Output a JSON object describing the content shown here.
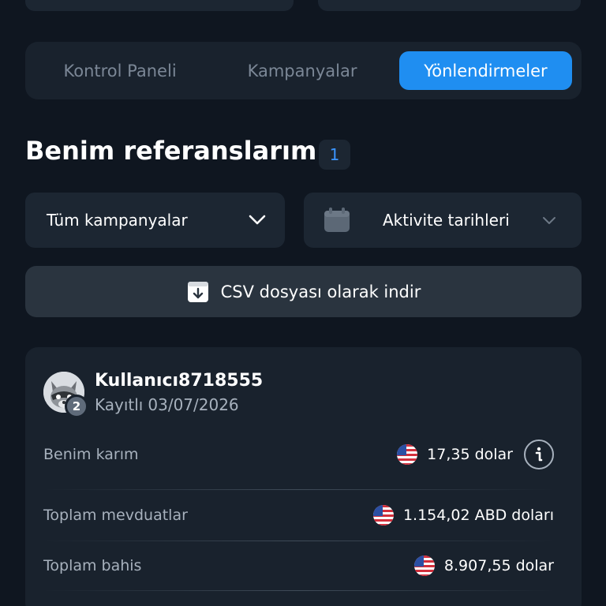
{
  "tabs": [
    {
      "label": "Kontrol Paneli",
      "active": false
    },
    {
      "label": "Kampanyalar",
      "active": false
    },
    {
      "label": "Yönlendirmeler",
      "active": true
    }
  ],
  "section": {
    "title": "Benim referanslarım",
    "count": "1"
  },
  "filters": {
    "campaign_dropdown": {
      "label": "Tüm kampanyalar",
      "icon": "chevron-down-icon"
    },
    "date_dropdown": {
      "label": "Aktivite tarihleri",
      "icon": "calendar-icon"
    }
  },
  "csv_button": {
    "label": "CSV dosyası olarak indir",
    "icon": "download-icon"
  },
  "referral": {
    "username": "Kullanıcı8718555",
    "registered_label": "Kayıtlı",
    "registered_date": "03/07/2026",
    "level": "2",
    "stats": [
      {
        "label": "Benim karım",
        "value": "17,35 dolar",
        "icon": "us-flag-icon",
        "has_info": true
      },
      {
        "label": "Toplam mevduatlar",
        "value": "1.154,02 ABD doları",
        "icon": "us-flag-icon",
        "has_info": false
      },
      {
        "label": "Toplam bahis",
        "value": "8.907,55 dolar",
        "icon": "us-flag-icon",
        "has_info": false
      }
    ]
  },
  "colors": {
    "accent": "#1f8ef1",
    "background": "#0f1620",
    "card": "#19222d"
  }
}
